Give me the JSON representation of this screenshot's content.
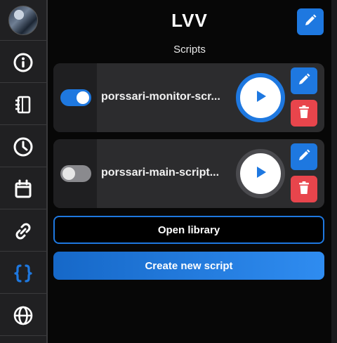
{
  "app": {
    "title": "LVV",
    "subtitle": "Scripts",
    "accent": "#1e78e0",
    "danger": "#e8454c"
  },
  "sidebar": {
    "items": [
      {
        "name": "avatar",
        "icon": "avatar"
      },
      {
        "name": "info",
        "icon": "info-icon"
      },
      {
        "name": "notebook",
        "icon": "notebook-icon"
      },
      {
        "name": "history",
        "icon": "clock-icon"
      },
      {
        "name": "calendar",
        "icon": "calendar-icon"
      },
      {
        "name": "links",
        "icon": "link-icon"
      },
      {
        "name": "scripts",
        "icon": "braces-icon",
        "active": true
      },
      {
        "name": "web",
        "icon": "globe-icon"
      }
    ]
  },
  "scripts": [
    {
      "name": "porssari-monitor-scr...",
      "enabled": true,
      "running": true
    },
    {
      "name": "porssari-main-script...",
      "enabled": false,
      "running": false
    }
  ],
  "actions": {
    "open_library": "Open library",
    "create_new": "Create new script"
  }
}
